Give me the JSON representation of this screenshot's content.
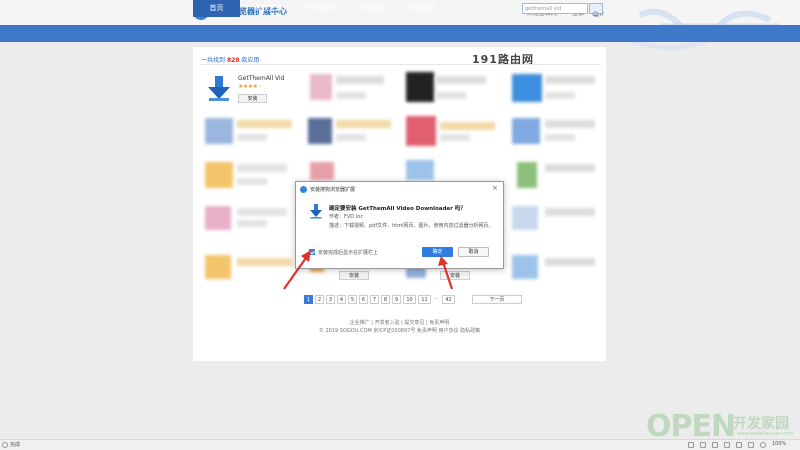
{
  "header": {
    "site_title": "搜狗浏览器扩展中心",
    "links": [
      "浏览器官网",
      "登录",
      "注册"
    ]
  },
  "nav": {
    "items": [
      "首页",
      "系统工具",
      "社交通讯",
      "生活服务",
      "休闲娱乐"
    ],
    "active_index": 0,
    "search_placeholder": "getthemall vid"
  },
  "results": {
    "prefix": "一共找到",
    "count": "828",
    "suffix": "款应用"
  },
  "watermark_191": "191路由网",
  "first_card": {
    "name": "GetThemAll Vid",
    "stars": 4,
    "stars_filled": "★★★★",
    "stars_empty": "☆",
    "install_label": "安装"
  },
  "install_label": "安装",
  "dialog": {
    "title": "安装搜狗浏览器扩展",
    "close": "×",
    "question": "确定要安装 GetThemAll Video Downloader 吗？",
    "author": "作者：FVD Inc",
    "description": "描述：下载视频、pdf文件、html网页、图片，使用内容过滤器分析网页。",
    "checkbox_label": "安装完成后显示在扩展栏上",
    "confirm_label": "确定",
    "cancel_label": "取消"
  },
  "pager": {
    "pages": [
      "1",
      "2",
      "3",
      "4",
      "5",
      "6",
      "7",
      "8",
      "9",
      "10",
      "11"
    ],
    "ellipsis": "...",
    "last": "42",
    "next": "下一页",
    "current": "1"
  },
  "footer": {
    "links": "企业推广 | 开发者入驻 | 提交意见 | 免责声明",
    "copyright": "© 2019 SOGOU.COM 京ICP证050897号 免责声明 用户协议 隐私政策"
  },
  "status": {
    "text": "完成",
    "zoom": "100%"
  },
  "watermark_open": {
    "text": "OPEN",
    "cn": "开发家园",
    "url": "www.kaifajiayuan.com"
  }
}
